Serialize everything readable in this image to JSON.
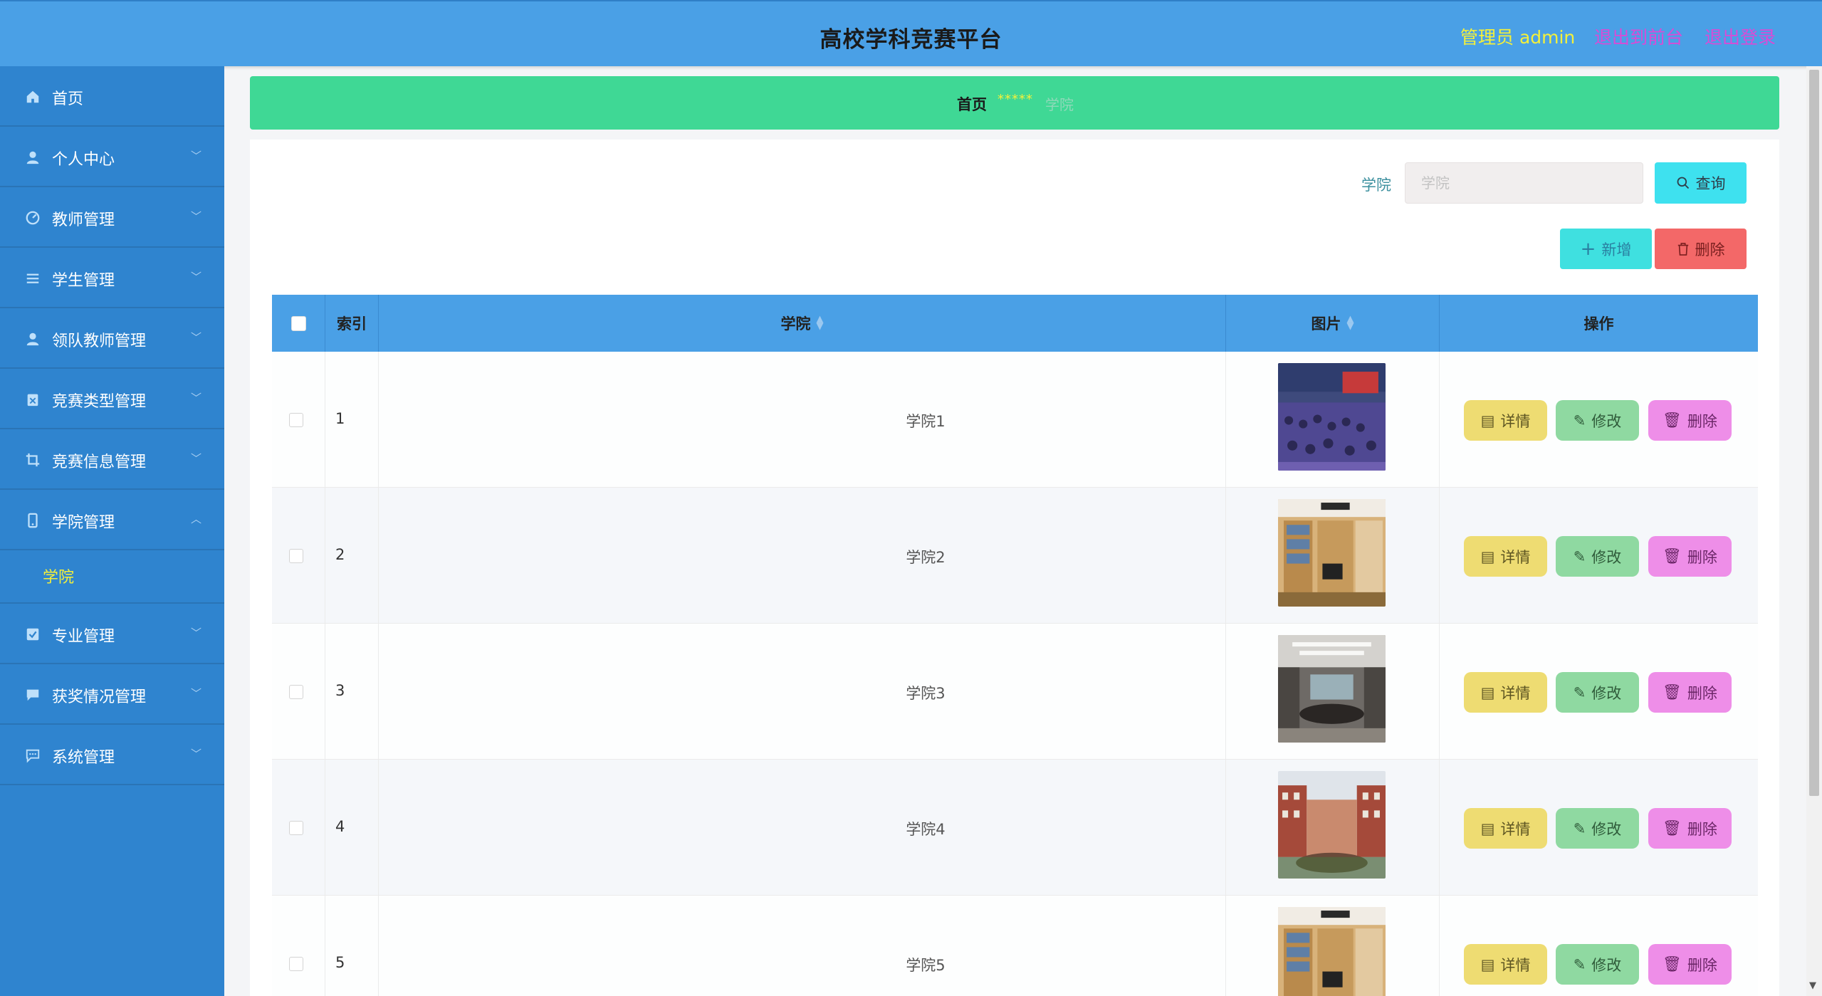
{
  "header": {
    "title": "高校学科竞赛平台",
    "admin": "管理员 admin",
    "front_link": "退出到前台",
    "logout_link": "退出登录"
  },
  "sidebar": {
    "items": [
      {
        "label": "首页",
        "icon": "home-icon",
        "arrow": false
      },
      {
        "label": "个人中心",
        "icon": "user-icon",
        "arrow": true
      },
      {
        "label": "教师管理",
        "icon": "dashboard-icon",
        "arrow": true
      },
      {
        "label": "学生管理",
        "icon": "list-icon",
        "arrow": true
      },
      {
        "label": "领队教师管理",
        "icon": "user-icon",
        "arrow": true
      },
      {
        "label": "竞赛类型管理",
        "icon": "clipboard-icon",
        "arrow": true
      },
      {
        "label": "竞赛信息管理",
        "icon": "crop-icon",
        "arrow": true
      },
      {
        "label": "学院管理",
        "icon": "phone-icon",
        "arrow": true,
        "expanded": true
      },
      {
        "label": "专业管理",
        "icon": "checkbox-icon",
        "arrow": true
      },
      {
        "label": "获奖情况管理",
        "icon": "chat-icon",
        "arrow": true
      },
      {
        "label": "系统管理",
        "icon": "message-icon",
        "arrow": true
      }
    ],
    "submenu_label": "学院"
  },
  "breadcrumb": {
    "home": "首页",
    "stars": "*****",
    "current": "学院"
  },
  "search": {
    "label": "学院",
    "placeholder": "学院",
    "value": "",
    "query_button": "查询"
  },
  "toolbar": {
    "add_button": "新增",
    "delete_button": "删除"
  },
  "table": {
    "columns": [
      "",
      "索引",
      "学院",
      "图片",
      "操作"
    ],
    "rows": [
      {
        "index": "1",
        "college": "学院1",
        "image": "auditorium"
      },
      {
        "index": "2",
        "college": "学院2",
        "image": "library-room"
      },
      {
        "index": "3",
        "college": "学院3",
        "image": "meeting-room"
      },
      {
        "index": "4",
        "college": "学院4",
        "image": "campus-building"
      },
      {
        "index": "5",
        "college": "学院5",
        "image": "library-room"
      }
    ],
    "actions": {
      "detail": "详情",
      "edit": "修改",
      "delete": "删除"
    }
  }
}
